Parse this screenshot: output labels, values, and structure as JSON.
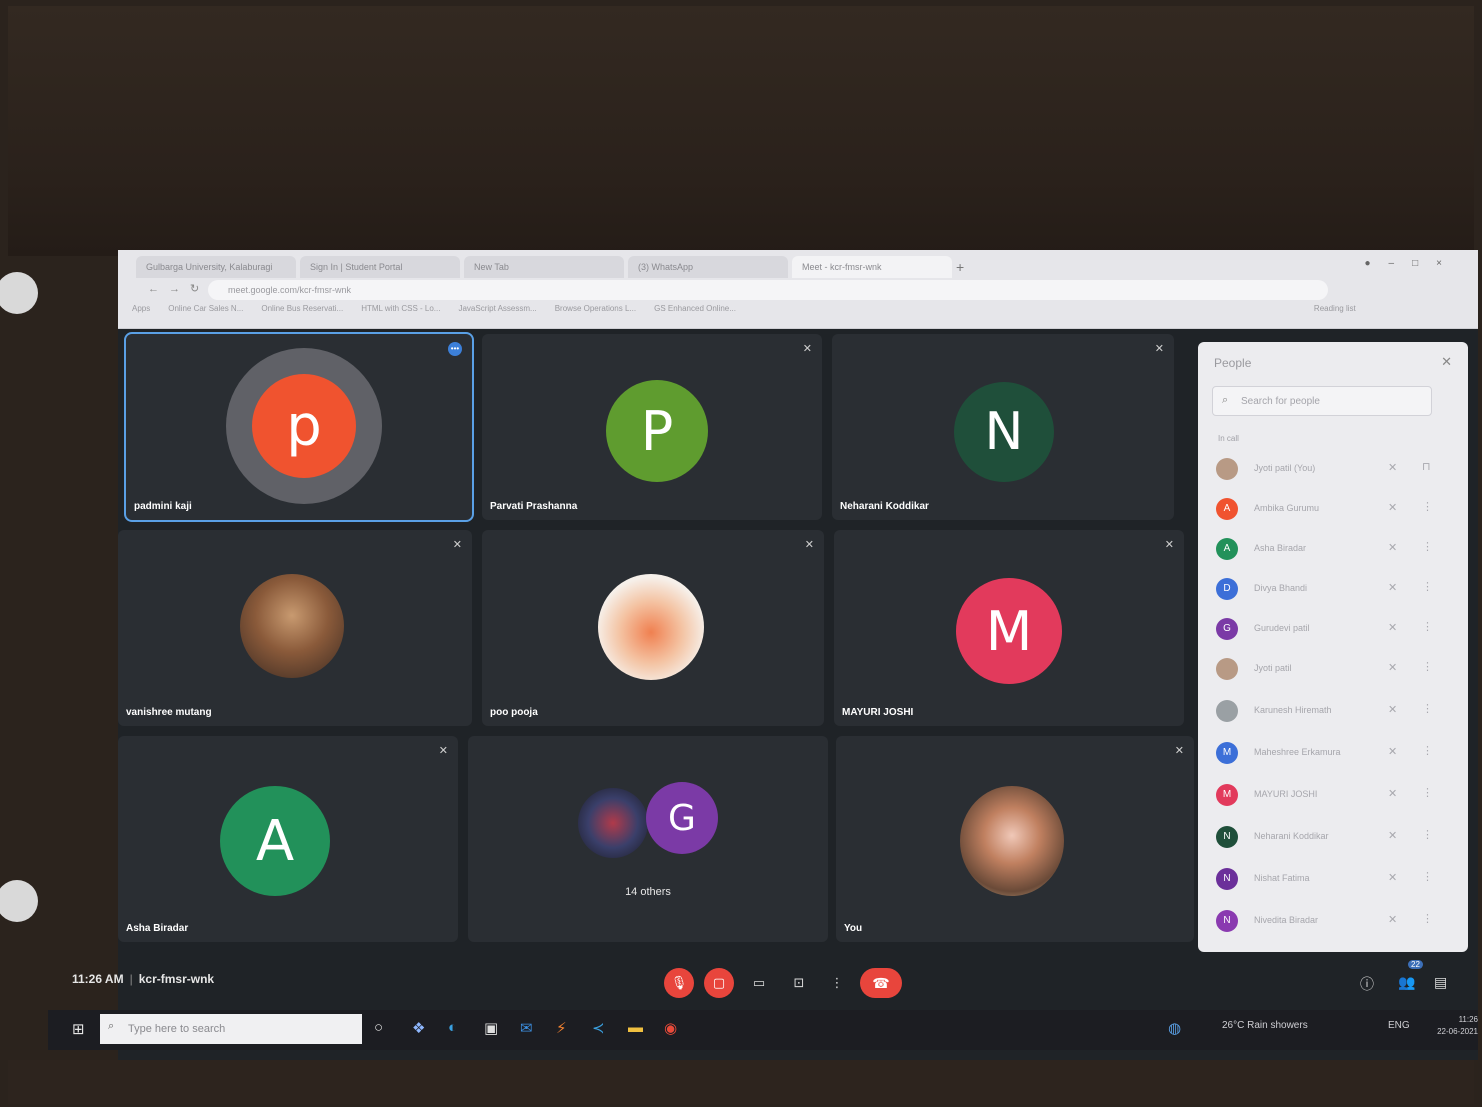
{
  "browser": {
    "tabs": [
      "Gulbarga University, Kalaburagi",
      "Sign In | Student Portal",
      "New Tab",
      "(3) WhatsApp",
      "Meet - kcr-fmsr-wnk"
    ],
    "address": "meet.google.com/kcr-fmsr-wnk",
    "bookmarks": [
      "Apps",
      "Online Car Sales N...",
      "Online Bus Reservati...",
      "HTML with CSS - Lo...",
      "JavaScript Assessm...",
      "Browse Operations L...",
      "GS Enhanced Online..."
    ],
    "reading_list": "Reading list"
  },
  "tiles": [
    {
      "name": "padmini kaji",
      "initial": "p",
      "color": "#f0532f"
    },
    {
      "name": "Parvati Prashanna",
      "initial": "P",
      "color": "#5f9c2f"
    },
    {
      "name": "Neharani Koddikar",
      "initial": "N",
      "color": "#1f4f3a"
    },
    {
      "name": "vanishree mutang"
    },
    {
      "name": "poo pooja"
    },
    {
      "name": "MAYURI JOSHI",
      "initial": "M",
      "color": "#e23a5c"
    },
    {
      "name": "Asha Biradar",
      "initial": "A",
      "color": "#22915a"
    },
    {
      "name": "14 others",
      "initial": "G",
      "color": "#7b3aa6"
    },
    {
      "name": "You"
    }
  ],
  "people_panel": {
    "title": "People",
    "search_placeholder": "Search for people",
    "section": "In call",
    "people": [
      {
        "name": "Jyoti patil (You)",
        "initial": "",
        "color": "#b89a85"
      },
      {
        "name": "Ambika Gurumu",
        "initial": "A",
        "color": "#f0532f"
      },
      {
        "name": "Asha Biradar",
        "initial": "A",
        "color": "#22915a"
      },
      {
        "name": "Divya Bhandi",
        "initial": "D",
        "color": "#3c6fd8"
      },
      {
        "name": "Gurudevi patil",
        "initial": "G",
        "color": "#7b3aa6"
      },
      {
        "name": "Jyoti patil",
        "initial": "",
        "color": "#b89a85"
      },
      {
        "name": "Karunesh Hiremath",
        "initial": "",
        "color": "#9aa0a4"
      },
      {
        "name": "Maheshree Erkamura",
        "initial": "M",
        "color": "#3c6fd8"
      },
      {
        "name": "MAYURI JOSHI",
        "initial": "M",
        "color": "#e23a5c"
      },
      {
        "name": "Neharani Koddikar",
        "initial": "N",
        "color": "#1f4f3a"
      },
      {
        "name": "Nishat Fatima",
        "initial": "N",
        "color": "#6b2f9a"
      },
      {
        "name": "Nivedita Biradar",
        "initial": "N",
        "color": "#8a3ab0"
      }
    ]
  },
  "meeting": {
    "time": "11:26 AM",
    "code": "kcr-fmsr-wnk",
    "participant_count": "22"
  },
  "taskbar": {
    "search_placeholder": "Type here to search",
    "weather": "26°C  Rain showers",
    "lang": "ENG",
    "time": "11:26",
    "date": "22-06-2021"
  }
}
